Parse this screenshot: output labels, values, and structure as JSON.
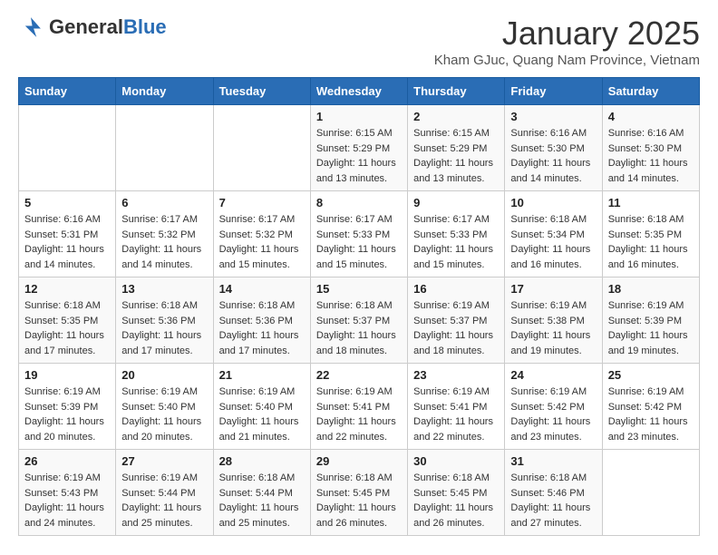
{
  "header": {
    "logo_general": "General",
    "logo_blue": "Blue",
    "month_title": "January 2025",
    "subtitle": "Kham GJuc, Quang Nam Province, Vietnam"
  },
  "weekdays": [
    "Sunday",
    "Monday",
    "Tuesday",
    "Wednesday",
    "Thursday",
    "Friday",
    "Saturday"
  ],
  "weeks": [
    [
      {
        "day": "",
        "info": ""
      },
      {
        "day": "",
        "info": ""
      },
      {
        "day": "",
        "info": ""
      },
      {
        "day": "1",
        "info": "Sunrise: 6:15 AM\nSunset: 5:29 PM\nDaylight: 11 hours and 13 minutes."
      },
      {
        "day": "2",
        "info": "Sunrise: 6:15 AM\nSunset: 5:29 PM\nDaylight: 11 hours and 13 minutes."
      },
      {
        "day": "3",
        "info": "Sunrise: 6:16 AM\nSunset: 5:30 PM\nDaylight: 11 hours and 14 minutes."
      },
      {
        "day": "4",
        "info": "Sunrise: 6:16 AM\nSunset: 5:30 PM\nDaylight: 11 hours and 14 minutes."
      }
    ],
    [
      {
        "day": "5",
        "info": "Sunrise: 6:16 AM\nSunset: 5:31 PM\nDaylight: 11 hours and 14 minutes."
      },
      {
        "day": "6",
        "info": "Sunrise: 6:17 AM\nSunset: 5:32 PM\nDaylight: 11 hours and 14 minutes."
      },
      {
        "day": "7",
        "info": "Sunrise: 6:17 AM\nSunset: 5:32 PM\nDaylight: 11 hours and 15 minutes."
      },
      {
        "day": "8",
        "info": "Sunrise: 6:17 AM\nSunset: 5:33 PM\nDaylight: 11 hours and 15 minutes."
      },
      {
        "day": "9",
        "info": "Sunrise: 6:17 AM\nSunset: 5:33 PM\nDaylight: 11 hours and 15 minutes."
      },
      {
        "day": "10",
        "info": "Sunrise: 6:18 AM\nSunset: 5:34 PM\nDaylight: 11 hours and 16 minutes."
      },
      {
        "day": "11",
        "info": "Sunrise: 6:18 AM\nSunset: 5:35 PM\nDaylight: 11 hours and 16 minutes."
      }
    ],
    [
      {
        "day": "12",
        "info": "Sunrise: 6:18 AM\nSunset: 5:35 PM\nDaylight: 11 hours and 17 minutes."
      },
      {
        "day": "13",
        "info": "Sunrise: 6:18 AM\nSunset: 5:36 PM\nDaylight: 11 hours and 17 minutes."
      },
      {
        "day": "14",
        "info": "Sunrise: 6:18 AM\nSunset: 5:36 PM\nDaylight: 11 hours and 17 minutes."
      },
      {
        "day": "15",
        "info": "Sunrise: 6:18 AM\nSunset: 5:37 PM\nDaylight: 11 hours and 18 minutes."
      },
      {
        "day": "16",
        "info": "Sunrise: 6:19 AM\nSunset: 5:37 PM\nDaylight: 11 hours and 18 minutes."
      },
      {
        "day": "17",
        "info": "Sunrise: 6:19 AM\nSunset: 5:38 PM\nDaylight: 11 hours and 19 minutes."
      },
      {
        "day": "18",
        "info": "Sunrise: 6:19 AM\nSunset: 5:39 PM\nDaylight: 11 hours and 19 minutes."
      }
    ],
    [
      {
        "day": "19",
        "info": "Sunrise: 6:19 AM\nSunset: 5:39 PM\nDaylight: 11 hours and 20 minutes."
      },
      {
        "day": "20",
        "info": "Sunrise: 6:19 AM\nSunset: 5:40 PM\nDaylight: 11 hours and 20 minutes."
      },
      {
        "day": "21",
        "info": "Sunrise: 6:19 AM\nSunset: 5:40 PM\nDaylight: 11 hours and 21 minutes."
      },
      {
        "day": "22",
        "info": "Sunrise: 6:19 AM\nSunset: 5:41 PM\nDaylight: 11 hours and 22 minutes."
      },
      {
        "day": "23",
        "info": "Sunrise: 6:19 AM\nSunset: 5:41 PM\nDaylight: 11 hours and 22 minutes."
      },
      {
        "day": "24",
        "info": "Sunrise: 6:19 AM\nSunset: 5:42 PM\nDaylight: 11 hours and 23 minutes."
      },
      {
        "day": "25",
        "info": "Sunrise: 6:19 AM\nSunset: 5:42 PM\nDaylight: 11 hours and 23 minutes."
      }
    ],
    [
      {
        "day": "26",
        "info": "Sunrise: 6:19 AM\nSunset: 5:43 PM\nDaylight: 11 hours and 24 minutes."
      },
      {
        "day": "27",
        "info": "Sunrise: 6:19 AM\nSunset: 5:44 PM\nDaylight: 11 hours and 25 minutes."
      },
      {
        "day": "28",
        "info": "Sunrise: 6:18 AM\nSunset: 5:44 PM\nDaylight: 11 hours and 25 minutes."
      },
      {
        "day": "29",
        "info": "Sunrise: 6:18 AM\nSunset: 5:45 PM\nDaylight: 11 hours and 26 minutes."
      },
      {
        "day": "30",
        "info": "Sunrise: 6:18 AM\nSunset: 5:45 PM\nDaylight: 11 hours and 26 minutes."
      },
      {
        "day": "31",
        "info": "Sunrise: 6:18 AM\nSunset: 5:46 PM\nDaylight: 11 hours and 27 minutes."
      },
      {
        "day": "",
        "info": ""
      }
    ]
  ]
}
